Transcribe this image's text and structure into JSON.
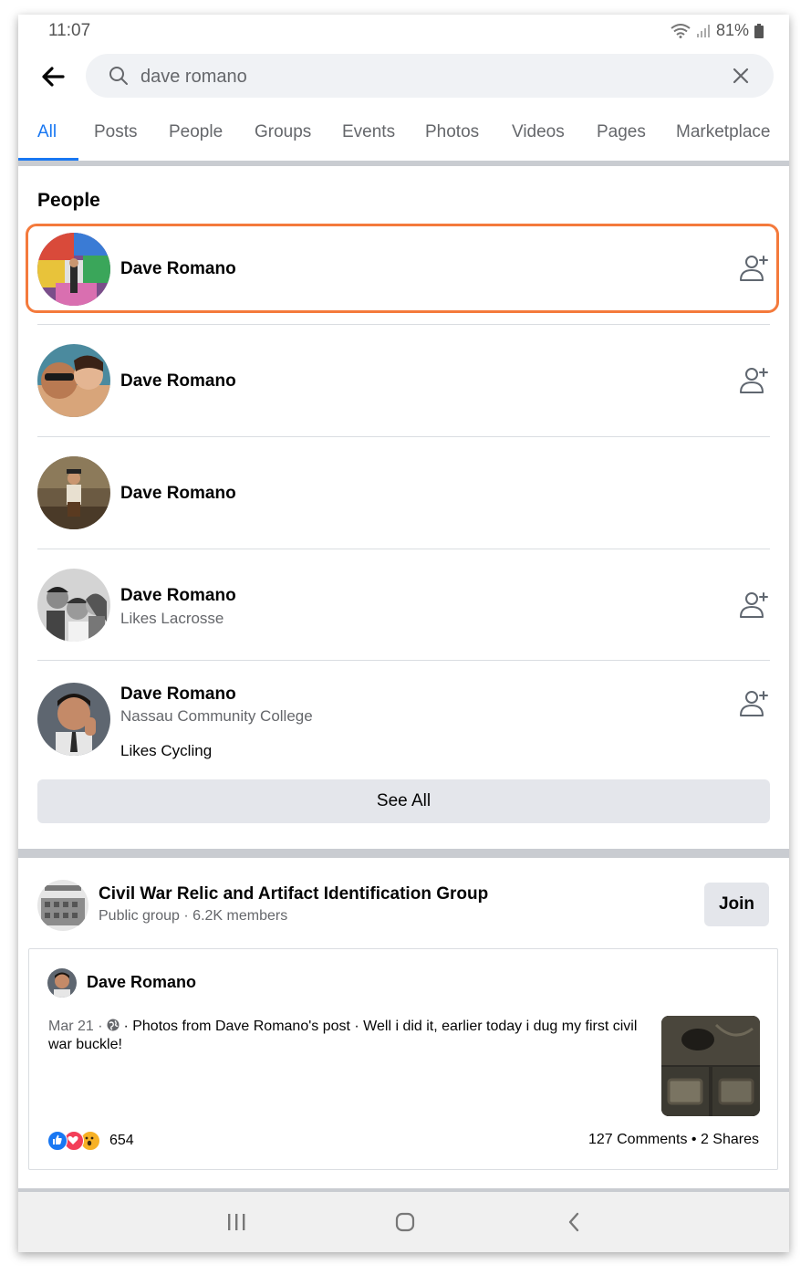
{
  "status_bar": {
    "time": "11:07",
    "battery": "81%"
  },
  "search": {
    "query": "dave romano"
  },
  "tabs": [
    {
      "label": "All"
    },
    {
      "label": "Posts"
    },
    {
      "label": "People"
    },
    {
      "label": "Groups"
    },
    {
      "label": "Events"
    },
    {
      "label": "Photos"
    },
    {
      "label": "Videos"
    },
    {
      "label": "Pages"
    },
    {
      "label": "Marketplace"
    }
  ],
  "people": {
    "title": "People",
    "results": [
      {
        "name": "Dave Romano",
        "lines": []
      },
      {
        "name": "Dave Romano",
        "lines": []
      },
      {
        "name": "Dave Romano",
        "lines": []
      },
      {
        "name": "Dave Romano",
        "lines": [
          "Likes Lacrosse"
        ]
      },
      {
        "name": "Dave Romano",
        "lines": [
          "Nassau Community College",
          "Likes Cycling"
        ]
      }
    ],
    "see_all_label": "See All"
  },
  "group": {
    "name": "Civil War Relic and Artifact Identification Group",
    "meta": "Public group · 6.2K members",
    "join_label": "Join"
  },
  "post": {
    "author": "Dave Romano",
    "date": "Mar 21 · ",
    "text": " · Photos from Dave Romano's post · Well i did it, earlier today i dug my first civil war buckle!",
    "reaction_count": "654",
    "stats": "127 Comments • 2 Shares"
  },
  "colors": {
    "accent": "#1877f2",
    "highlight": "#f47a3c",
    "like": "#1877f2",
    "love": "#f33e58",
    "wow": "#f7b125"
  }
}
